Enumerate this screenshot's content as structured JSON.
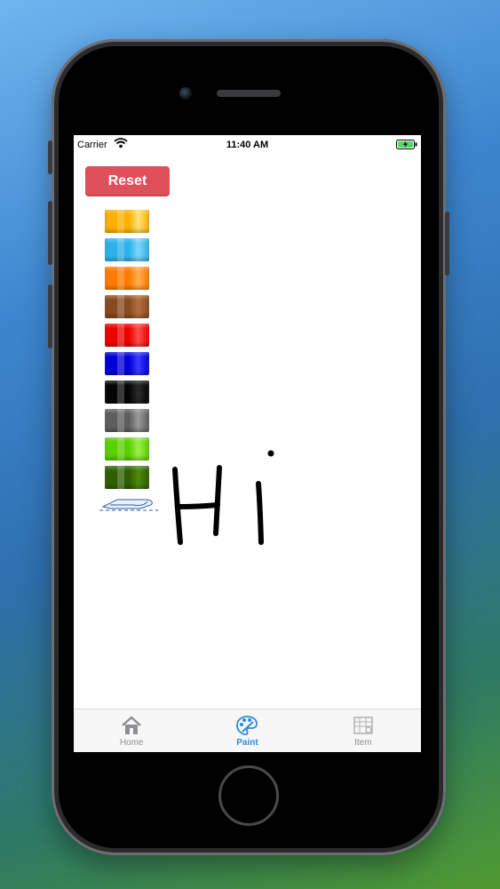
{
  "status_bar": {
    "carrier": "Carrier",
    "time": "11:40 AM"
  },
  "toolbar": {
    "reset_label": "Reset"
  },
  "palette": {
    "colors": [
      {
        "name": "yellow-orange",
        "base": "#ffb000",
        "accent": "#ffe27a"
      },
      {
        "name": "sky-blue",
        "base": "#2bb3ea",
        "accent": "#7fd6f7"
      },
      {
        "name": "orange",
        "base": "#ff7a00",
        "accent": "#ffae4d"
      },
      {
        "name": "brown",
        "base": "#8a4a1f",
        "accent": "#b47040"
      },
      {
        "name": "red",
        "base": "#ee0000",
        "accent": "#ff4d4d"
      },
      {
        "name": "blue",
        "base": "#0000d8",
        "accent": "#3b3bff"
      },
      {
        "name": "black",
        "base": "#050505",
        "accent": "#2a2a2a"
      },
      {
        "name": "gray",
        "base": "#5e5e5e",
        "accent": "#9a9a9a"
      },
      {
        "name": "lime-green",
        "base": "#5bd000",
        "accent": "#9aee4a"
      },
      {
        "name": "dark-green",
        "base": "#2f5e00",
        "accent": "#4e8a10"
      }
    ],
    "eraser_icon": "eraser-icon"
  },
  "canvas": {
    "drawing_text": "Hi",
    "stroke_color": "#000000"
  },
  "tabbar": {
    "active_color": "#2e8bd6",
    "tabs": [
      {
        "label": "Home",
        "icon": "house-icon"
      },
      {
        "label": "Paint",
        "icon": "palette-icon"
      },
      {
        "label": "Item",
        "icon": "item-icon"
      }
    ]
  },
  "colors": {
    "reset_button": "#e0505b",
    "battery": "#4cd964"
  }
}
